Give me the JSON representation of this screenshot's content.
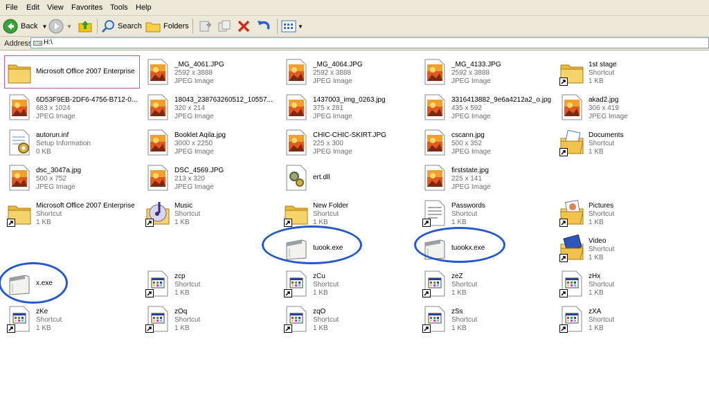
{
  "menu": [
    "File",
    "Edit",
    "View",
    "Favorites",
    "Tools",
    "Help"
  ],
  "toolbar": {
    "back_label": "Back",
    "search_label": "Search",
    "folders_label": "Folders"
  },
  "address": {
    "label": "Address",
    "path": "H:\\"
  },
  "colors": {
    "chrome": "#ece9d8",
    "highlight_circle": "#2459c7",
    "selection_border": "#b85ba6",
    "sub_text": "#6d6d6d"
  },
  "items": [
    {
      "name": "Microsoft Office 2007 Enterprise",
      "sub1": "",
      "sub2": "",
      "icon": "folder-icon",
      "shortcut": false,
      "selected": true,
      "circled": false
    },
    {
      "name": "_MG_4061.JPG",
      "sub1": "2592 x 3888",
      "sub2": "JPEG Image",
      "icon": "jpeg-image-icon",
      "shortcut": false,
      "selected": false,
      "circled": false
    },
    {
      "name": "_MG_4064.JPG",
      "sub1": "2592 x 3888",
      "sub2": "JPEG Image",
      "icon": "jpeg-image-icon",
      "shortcut": false,
      "selected": false,
      "circled": false
    },
    {
      "name": "_MG_4133.JPG",
      "sub1": "2592 x 3888",
      "sub2": "JPEG Image",
      "icon": "jpeg-image-icon",
      "shortcut": false,
      "selected": false,
      "circled": false
    },
    {
      "name": "1st stage",
      "sub1": "Shortcut",
      "sub2": "1 KB",
      "icon": "folder-icon",
      "shortcut": true,
      "selected": false,
      "circled": false
    },
    {
      "name": "6D53F9EB-2DF6-4756-B712-0...",
      "sub1": "683 x 1024",
      "sub2": "JPEG Image",
      "icon": "jpeg-image-icon",
      "shortcut": false,
      "selected": false,
      "circled": false
    },
    {
      "name": "18043_238763260512_10557...",
      "sub1": "320 x 214",
      "sub2": "JPEG Image",
      "icon": "jpeg-image-icon",
      "shortcut": false,
      "selected": false,
      "circled": false
    },
    {
      "name": "1437003_img_0263.jpg",
      "sub1": "375 x 281",
      "sub2": "JPEG Image",
      "icon": "jpeg-image-icon",
      "shortcut": false,
      "selected": false,
      "circled": false
    },
    {
      "name": "3316413882_9e6a4212a2_o.jpg",
      "sub1": "435 x 592",
      "sub2": "JPEG Image",
      "icon": "jpeg-image-icon",
      "shortcut": false,
      "selected": false,
      "circled": false
    },
    {
      "name": "akad2.jpg",
      "sub1": "306 x 419",
      "sub2": "JPEG Image",
      "icon": "jpeg-image-icon",
      "shortcut": false,
      "selected": false,
      "circled": false
    },
    {
      "name": "autorun.inf",
      "sub1": "Setup Information",
      "sub2": "0 KB",
      "icon": "setup-info-icon",
      "shortcut": false,
      "selected": false,
      "circled": false
    },
    {
      "name": "Booklet Aqila.jpg",
      "sub1": "3000 x 2250",
      "sub2": "JPEG Image",
      "icon": "jpeg-image-icon",
      "shortcut": false,
      "selected": false,
      "circled": false
    },
    {
      "name": "CHIC-CHIC-SKIRT.JPG",
      "sub1": "225 x 300",
      "sub2": "JPEG Image",
      "icon": "jpeg-image-icon",
      "shortcut": false,
      "selected": false,
      "circled": false
    },
    {
      "name": "cscann.jpg",
      "sub1": "500 x 352",
      "sub2": "JPEG Image",
      "icon": "jpeg-image-icon",
      "shortcut": false,
      "selected": false,
      "circled": false
    },
    {
      "name": "Documents",
      "sub1": "Shortcut",
      "sub2": "1 KB",
      "icon": "documents-folder-icon",
      "shortcut": true,
      "selected": false,
      "circled": false
    },
    {
      "name": "dsc_3047a.jpg",
      "sub1": "500 x 752",
      "sub2": "JPEG Image",
      "icon": "jpeg-image-icon",
      "shortcut": false,
      "selected": false,
      "circled": false
    },
    {
      "name": "DSC_4569.JPG",
      "sub1": "213 x 320",
      "sub2": "JPEG Image",
      "icon": "jpeg-image-icon",
      "shortcut": false,
      "selected": false,
      "circled": false
    },
    {
      "name": "ert.dll",
      "sub1": "",
      "sub2": "",
      "icon": "dll-gear-icon",
      "shortcut": false,
      "selected": false,
      "circled": false
    },
    {
      "name": "firststate.jpg",
      "sub1": "225 x 141",
      "sub2": "JPEG Image",
      "icon": "jpeg-image-icon",
      "shortcut": false,
      "selected": false,
      "circled": false
    },
    null,
    {
      "name": "Microsoft Office 2007 Enterprise",
      "sub1": "Shortcut",
      "sub2": "1 KB",
      "icon": "folder-icon",
      "shortcut": true,
      "selected": false,
      "circled": false
    },
    {
      "name": "Music",
      "sub1": "Shortcut",
      "sub2": "1 KB",
      "icon": "music-folder-icon",
      "shortcut": true,
      "selected": false,
      "circled": false
    },
    {
      "name": "New Folder",
      "sub1": "Shortcut",
      "sub2": "1 KB",
      "icon": "folder-icon",
      "shortcut": true,
      "selected": false,
      "circled": false
    },
    {
      "name": "Passwords",
      "sub1": "Shortcut",
      "sub2": "1 KB",
      "icon": "text-document-icon",
      "shortcut": true,
      "selected": false,
      "circled": false
    },
    {
      "name": "Pictures",
      "sub1": "Shortcut",
      "sub2": "1 KB",
      "icon": "pictures-folder-icon",
      "shortcut": true,
      "selected": false,
      "circled": false
    },
    null,
    null,
    {
      "name": "tuook.exe",
      "sub1": "",
      "sub2": "",
      "icon": "exe-window-icon",
      "shortcut": false,
      "selected": false,
      "circled": true
    },
    {
      "name": "tuookx.exe",
      "sub1": "",
      "sub2": "",
      "icon": "exe-window-icon",
      "shortcut": false,
      "selected": false,
      "circled": true
    },
    {
      "name": "Video",
      "sub1": "Shortcut",
      "sub2": "1 KB",
      "icon": "video-folder-icon",
      "shortcut": true,
      "selected": false,
      "circled": false
    },
    {
      "name": "x.exe",
      "sub1": "",
      "sub2": "",
      "icon": "exe-window-icon",
      "shortcut": false,
      "selected": false,
      "circled": true
    },
    {
      "name": "zcp",
      "sub1": "Shortcut",
      "sub2": "1 KB",
      "icon": "shortcut-file-icon",
      "shortcut": true,
      "selected": false,
      "circled": false
    },
    {
      "name": "zCu",
      "sub1": "Shortcut",
      "sub2": "1 KB",
      "icon": "shortcut-file-icon",
      "shortcut": true,
      "selected": false,
      "circled": false
    },
    {
      "name": "zeZ",
      "sub1": "Shortcut",
      "sub2": "1 KB",
      "icon": "shortcut-file-icon",
      "shortcut": true,
      "selected": false,
      "circled": false
    },
    {
      "name": "zHx",
      "sub1": "Shortcut",
      "sub2": "1 KB",
      "icon": "shortcut-file-icon",
      "shortcut": true,
      "selected": false,
      "circled": false
    },
    {
      "name": "zKe",
      "sub1": "Shortcut",
      "sub2": "1 KB",
      "icon": "shortcut-file-icon",
      "shortcut": true,
      "selected": false,
      "circled": false
    },
    {
      "name": "zOq",
      "sub1": "Shortcut",
      "sub2": "1 KB",
      "icon": "shortcut-file-icon",
      "shortcut": true,
      "selected": false,
      "circled": false
    },
    {
      "name": "zqO",
      "sub1": "Shortcut",
      "sub2": "1 KB",
      "icon": "shortcut-file-icon",
      "shortcut": true,
      "selected": false,
      "circled": false
    },
    {
      "name": "zSs",
      "sub1": "Shortcut",
      "sub2": "1 KB",
      "icon": "shortcut-file-icon",
      "shortcut": true,
      "selected": false,
      "circled": false
    },
    {
      "name": "zXA",
      "sub1": "Shortcut",
      "sub2": "1 KB",
      "icon": "shortcut-file-icon",
      "shortcut": true,
      "selected": false,
      "circled": false
    }
  ]
}
